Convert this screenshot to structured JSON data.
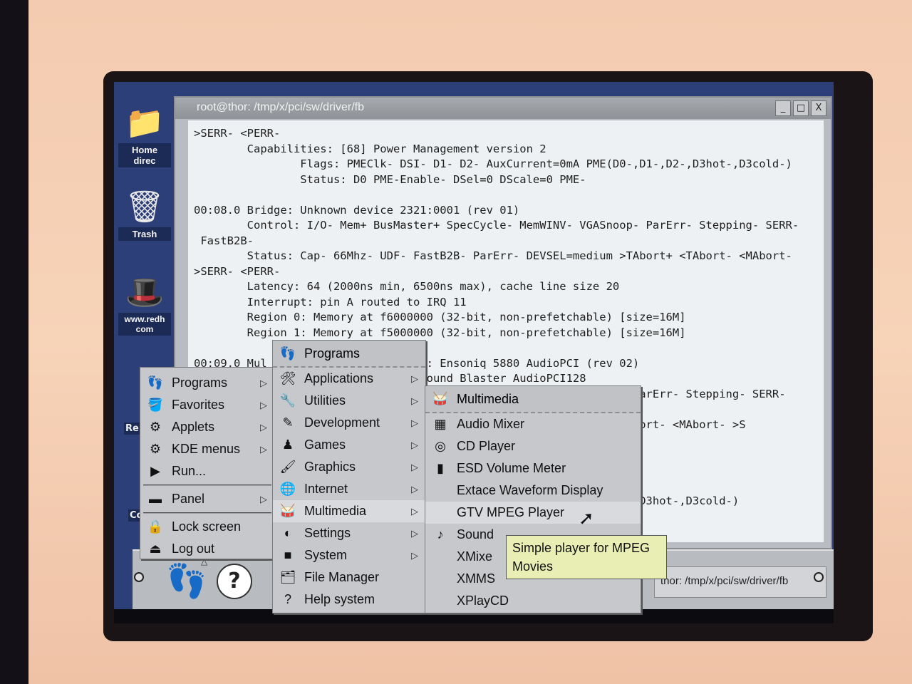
{
  "desktop": {
    "icons": [
      {
        "label": "Home direc",
        "icon": "folder-icon"
      },
      {
        "label": "Trash",
        "icon": "trash-icon"
      },
      {
        "label": "www.redh com",
        "icon": "redhat-icon"
      }
    ],
    "partial_labels": [
      "Re",
      "Co"
    ]
  },
  "terminal": {
    "title": "root@thor: /tmp/x/pci/sw/driver/fb",
    "buttons": [
      "_",
      "□",
      "X"
    ],
    "lines": [
      ">SERR- <PERR-",
      "        Capabilities: [68] Power Management version 2",
      "                Flags: PMEClk- DSI- D1- D2- AuxCurrent=0mA PME(D0-,D1-,D2-,D3hot-,D3cold-)",
      "                Status: D0 PME-Enable- DSel=0 DScale=0 PME-",
      "",
      "00:08.0 Bridge: Unknown device 2321:0001 (rev 01)",
      "        Control: I/O- Mem+ BusMaster+ SpecCycle- MemWINV- VGASnoop- ParErr- Stepping- SERR-",
      " FastB2B-",
      "        Status: Cap- 66Mhz- UDF- FastB2B- ParErr- DEVSEL=medium >TAbort+ <TAbort- <MAbort-",
      ">SERR- <PERR-",
      "        Latency: 64 (2000ns min, 6500ns max), cache line size 20",
      "        Interrupt: pin A routed to IRQ 11",
      "        Region 0: Memory at f6000000 (32-bit, non-prefetchable) [size=16M]",
      "        Region 1: Memory at f5000000 (32-bit, non-prefetchable) [size=16M]",
      "",
      "00:09.0 Mul                       r: Ensoniq 5880 AudioPCI (rev 02)",
      "        Sub                     e Sound Blaster AudioPCI128",
      "                                er+ SpecCycle- MemWINV- VGASnoop- ParErr- Stepping- SERR-",
      "",
      "                                                        Abort- <TAbort- <MAbort- >S",
      "",
      "",
      "",
      "",
      "                                                        0-,D1-,D2-,D3hot-,D3cold-)"
    ]
  },
  "taskbar": {
    "task_title": "thor: /tmp/x/pci/sw/driver/fb",
    "help_glyph": "?"
  },
  "menus": {
    "main": [
      {
        "label": "Programs",
        "icon": "footprint-icon",
        "submenu": true
      },
      {
        "label": "Favorites",
        "icon": "favorites-icon",
        "submenu": true
      },
      {
        "label": "Applets",
        "icon": "applets-icon",
        "submenu": true
      },
      {
        "label": "KDE menus",
        "icon": "kde-icon",
        "submenu": true
      },
      {
        "label": "Run...",
        "icon": "run-icon",
        "submenu": false
      },
      {
        "label": "Panel",
        "icon": "panel-icon",
        "submenu": true
      },
      {
        "label": "Lock screen",
        "icon": "lock-icon",
        "submenu": false
      },
      {
        "label": "Log out",
        "icon": "logout-icon",
        "submenu": false
      }
    ],
    "programs": {
      "title": "Programs",
      "items": [
        {
          "label": "Applications",
          "icon": "applications-icon",
          "submenu": true
        },
        {
          "label": "Utilities",
          "icon": "utilities-icon",
          "submenu": true
        },
        {
          "label": "Development",
          "icon": "development-icon",
          "submenu": true
        },
        {
          "label": "Games",
          "icon": "games-icon",
          "submenu": true
        },
        {
          "label": "Graphics",
          "icon": "graphics-icon",
          "submenu": true
        },
        {
          "label": "Internet",
          "icon": "internet-icon",
          "submenu": true
        },
        {
          "label": "Multimedia",
          "icon": "multimedia-icon",
          "submenu": true
        },
        {
          "label": "Settings",
          "icon": "settings-icon",
          "submenu": true
        },
        {
          "label": "System",
          "icon": "system-icon",
          "submenu": true
        },
        {
          "label": "File Manager",
          "icon": "file-manager-icon",
          "submenu": false
        },
        {
          "label": "Help system",
          "icon": "help-icon",
          "submenu": false
        }
      ]
    },
    "multimedia": {
      "title": "Multimedia",
      "items": [
        {
          "label": "Audio Mixer",
          "icon": "mixer-icon"
        },
        {
          "label": "CD Player",
          "icon": "cd-icon"
        },
        {
          "label": "ESD Volume Meter",
          "icon": "meter-icon"
        },
        {
          "label": "Extace Waveform Display",
          "icon": ""
        },
        {
          "label": "GTV MPEG Player",
          "icon": ""
        },
        {
          "label": "Sound",
          "icon": "sound-icon"
        },
        {
          "label": "XMixe",
          "icon": ""
        },
        {
          "label": "XMMS",
          "icon": ""
        },
        {
          "label": "XPlayCD",
          "icon": ""
        }
      ]
    }
  },
  "tooltip": {
    "line1": "Simple player for MPEG",
    "line2": "Movies"
  }
}
